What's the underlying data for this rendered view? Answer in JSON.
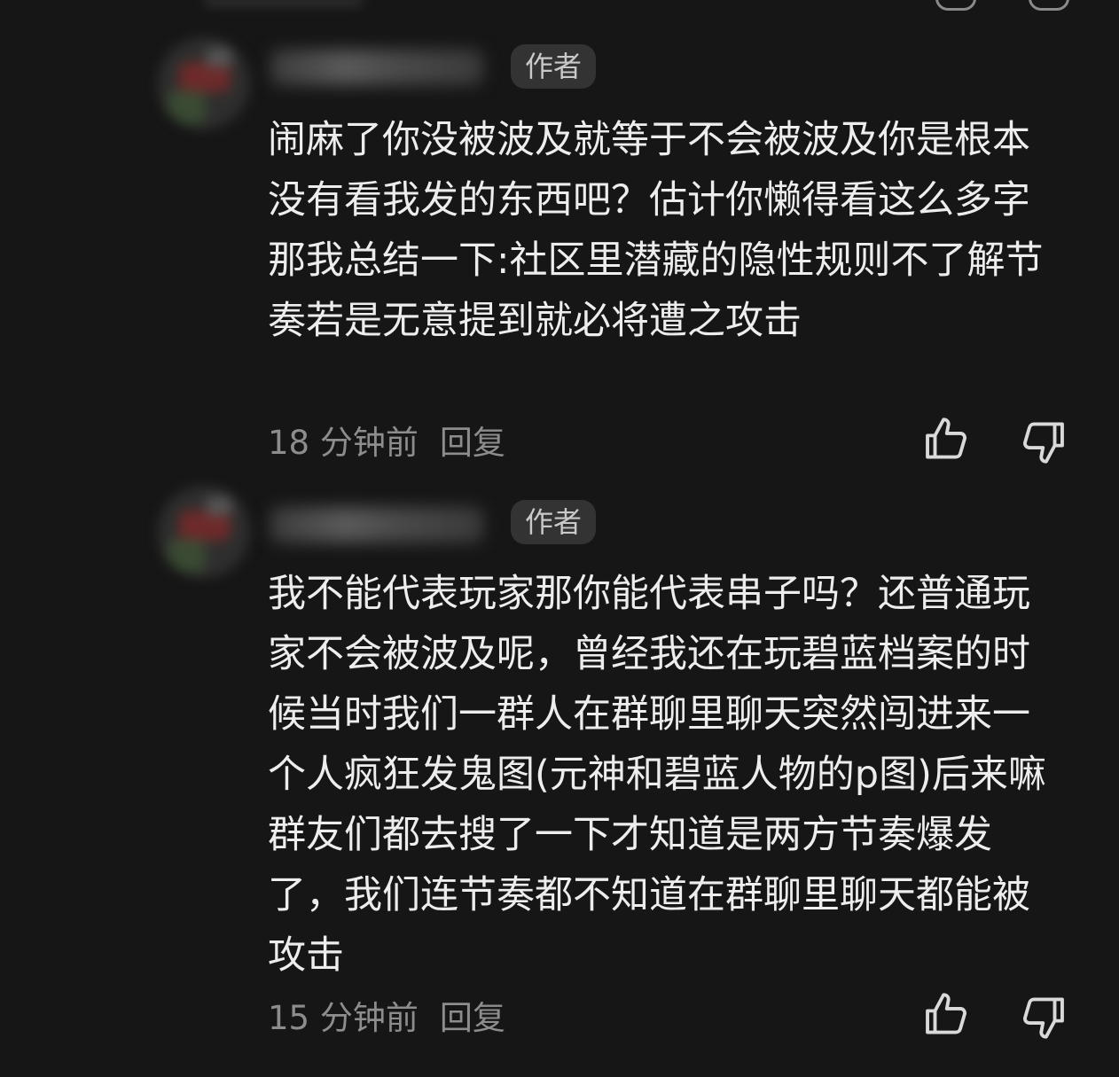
{
  "comments": [
    {
      "badge": "作者",
      "text": "闹麻了你没被波及就等于不会被波及你是根本没有看我发的东西吧？估计你懒得看这么多字那我总结一下:社区里潜藏的隐性规则不了解节奏若是无意提到就必将遭之攻击",
      "time": "18 分钟前",
      "reply_label": "回复",
      "like_icon": "thumbs-up-icon",
      "dislike_icon": "thumbs-down-icon"
    },
    {
      "badge": "作者",
      "text": "我不能代表玩家那你能代表串子吗？还普通玩家不会被波及呢，曾经我还在玩碧蓝档案的时候当时我们一群人在群聊里聊天突然闯进来一个人疯狂发鬼图(元神和碧蓝人物的p图)后来嘛群友们都去搜了一下才知道是两方节奏爆发了，我们连节奏都不知道在群聊里聊天都能被攻击",
      "time": "15 分钟前",
      "reply_label": "回复",
      "like_icon": "thumbs-up-icon",
      "dislike_icon": "thumbs-down-icon"
    }
  ],
  "colors": {
    "background": "#161616",
    "text": "#ededed",
    "meta": "#8d8d8d",
    "badge_bg": "#333333",
    "badge_text": "#c9c9c9",
    "icon_stroke": "#d9d9d9"
  }
}
